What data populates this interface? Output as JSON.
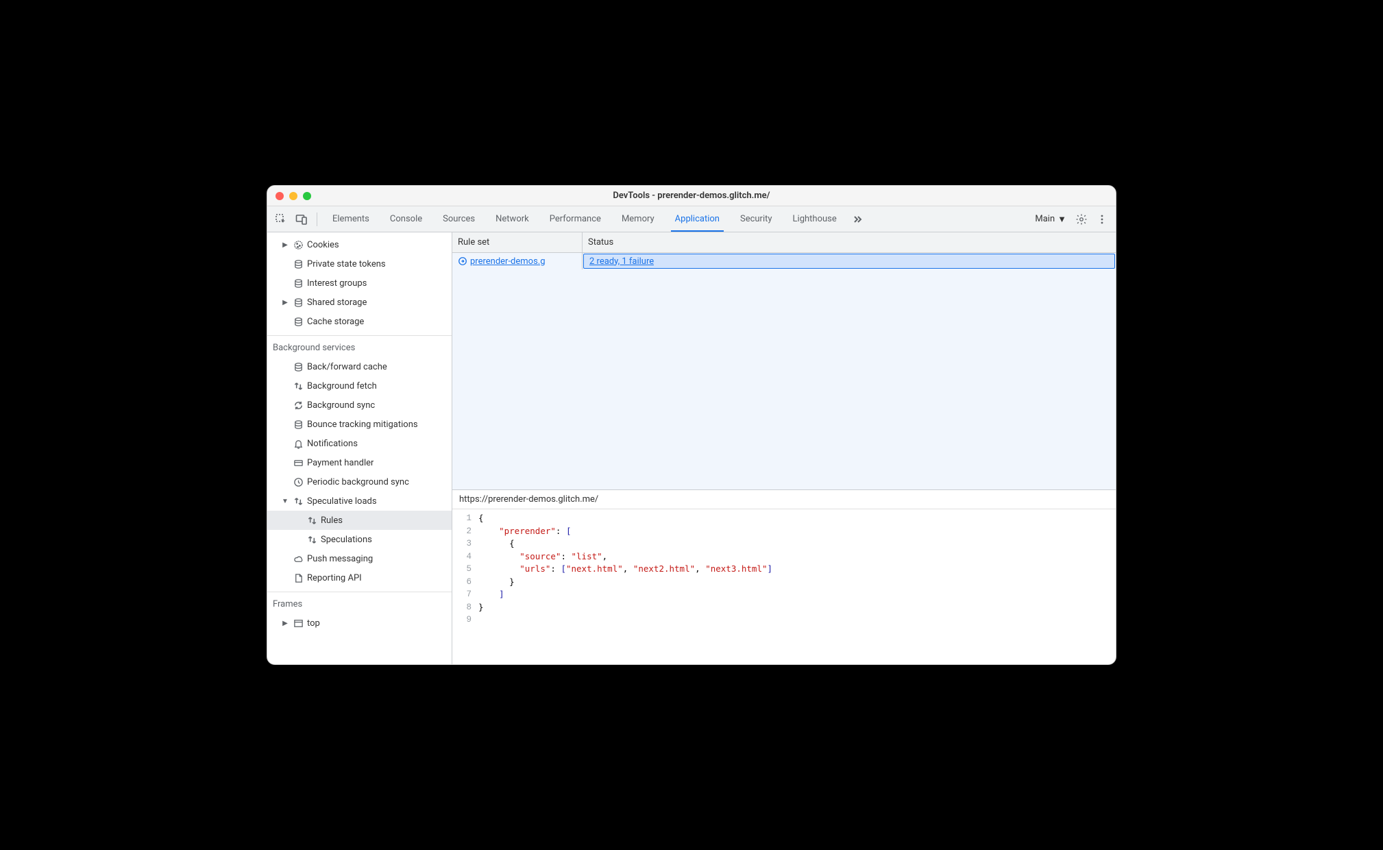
{
  "window_title": "DevTools - prerender-demos.glitch.me/",
  "tabs": {
    "elements": "Elements",
    "console": "Console",
    "sources": "Sources",
    "network": "Network",
    "performance": "Performance",
    "memory": "Memory",
    "application": "Application",
    "security": "Security",
    "lighthouse": "Lighthouse"
  },
  "frame_selector": "Main",
  "sidebar": {
    "storage": {
      "cookies": "Cookies",
      "private_state_tokens": "Private state tokens",
      "interest_groups": "Interest groups",
      "shared_storage": "Shared storage",
      "cache_storage": "Cache storage"
    },
    "background_header": "Background services",
    "background": {
      "back_forward_cache": "Back/forward cache",
      "background_fetch": "Background fetch",
      "background_sync": "Background sync",
      "bounce_tracking": "Bounce tracking mitigations",
      "notifications": "Notifications",
      "payment_handler": "Payment handler",
      "periodic_bg_sync": "Periodic background sync",
      "speculative_loads": "Speculative loads",
      "rules": "Rules",
      "speculations": "Speculations",
      "push_messaging": "Push messaging",
      "reporting_api": "Reporting API"
    },
    "frames_header": "Frames",
    "frames": {
      "top": "top"
    }
  },
  "grid": {
    "col_rule": "Rule set",
    "col_status": "Status",
    "rows": [
      {
        "rule": "prerender-demos.g",
        "status": "2 ready, 1 failure"
      }
    ]
  },
  "detail_url": "https://prerender-demos.glitch.me/",
  "code": {
    "line_count": 9,
    "k_prerender": "\"prerender\"",
    "k_source": "\"source\"",
    "v_list": "\"list\"",
    "k_urls": "\"urls\"",
    "v_url1": "\"next.html\"",
    "v_url2": "\"next2.html\"",
    "v_url3": "\"next3.html\""
  }
}
